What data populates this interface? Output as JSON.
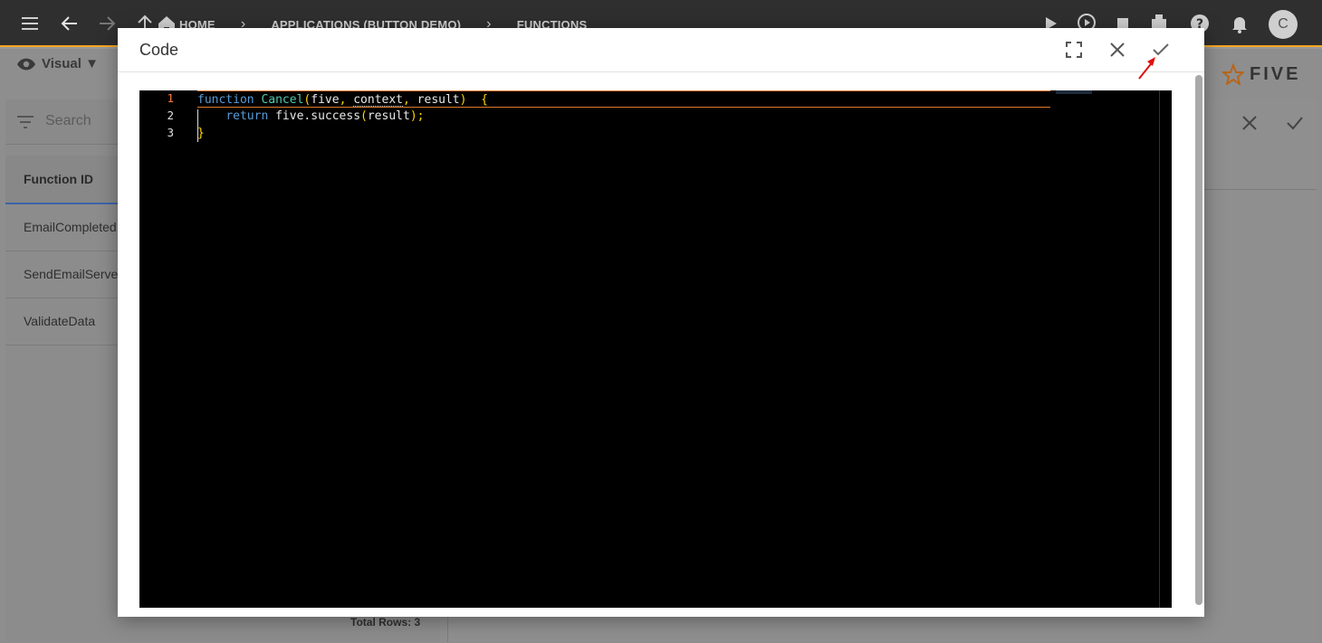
{
  "appbar": {
    "breadcrumbs": [
      "HOME",
      "APPLICATIONS (BUTTON DEMO)",
      "FUNCTIONS"
    ],
    "avatar_letter": "C"
  },
  "background": {
    "view_selector": "Visual ▼",
    "search_placeholder": "Search",
    "column_header": "Function ID",
    "rows": [
      "EmailCompleted",
      "SendEmailServer",
      "ValidateData"
    ],
    "total_rows": "Total Rows: 3",
    "logo_text": "FIVE"
  },
  "modal": {
    "title": "Code",
    "line_numbers": [
      "1",
      "2",
      "3"
    ],
    "code": {
      "line1": {
        "kw": "function",
        "fname": "Cancel",
        "open": "(",
        "p1": "five",
        "c1": ",",
        "p2": "context",
        "c2": ",",
        "p3": "result",
        "close": ")",
        "brace": "{"
      },
      "line2": {
        "kw": "return",
        "obj": "five.success",
        "open": "(",
        "arg": "result",
        "close": ");"
      },
      "line3": {
        "brace": "}"
      }
    }
  },
  "colors": {
    "appbar_bg": "#2f2f2f",
    "accent": "#f5a623",
    "editor_bg": "#000000",
    "keyword": "#569cd6",
    "function_name": "#4ec9b0",
    "punctuation": "#ffd700",
    "annotation_arrow": "#e01010"
  }
}
